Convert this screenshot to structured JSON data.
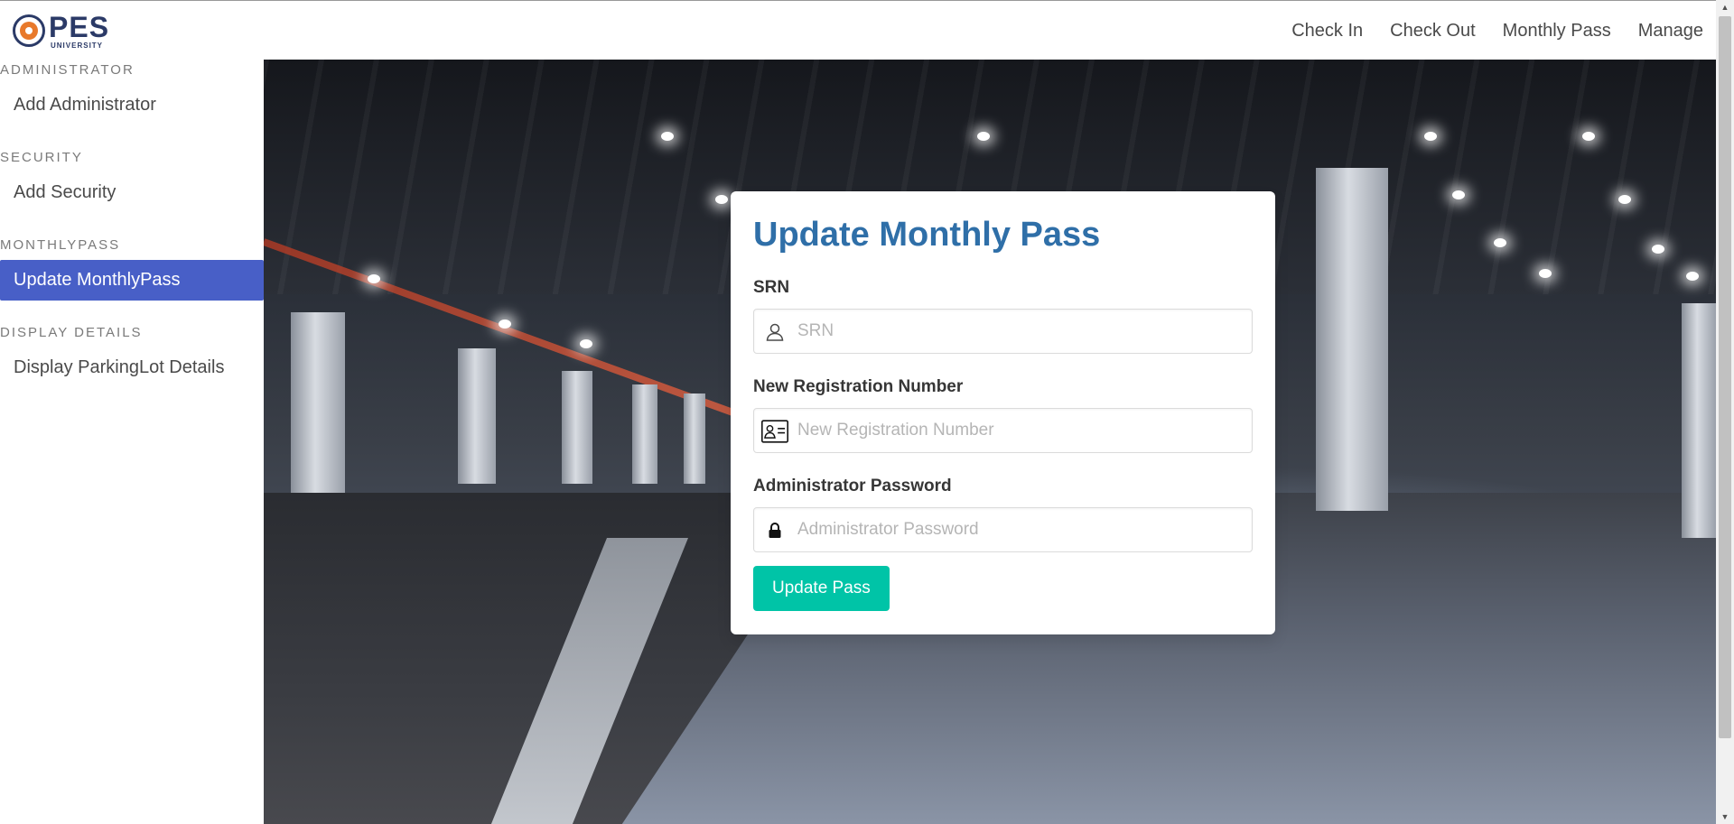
{
  "brand": {
    "main": "PES",
    "sub": "UNIVERSITY"
  },
  "nav": {
    "links": [
      "Check In",
      "Check Out",
      "Monthly Pass",
      "Manage"
    ]
  },
  "sidebar": {
    "sections": [
      {
        "label": "ADMINISTRATOR",
        "item": "Add Administrator"
      },
      {
        "label": "SECURITY",
        "item": "Add Security"
      },
      {
        "label": "MONTHLYPASS",
        "item": "Update MonthlyPass"
      },
      {
        "label": "DISPLAY DETAILS",
        "item": "Display ParkingLot Details"
      }
    ],
    "active_item": "Update MonthlyPass"
  },
  "form": {
    "title": "Update Monthly Pass",
    "fields": [
      {
        "label": "SRN",
        "placeholder": "SRN",
        "value": "",
        "icon": "user-icon"
      },
      {
        "label": "New Registration Number",
        "placeholder": "New Registration Number",
        "value": "",
        "icon": "id-card-icon"
      },
      {
        "label": "Administrator Password",
        "placeholder": "Administrator Password",
        "value": "",
        "icon": "lock-icon"
      }
    ],
    "submit_label": "Update Pass"
  },
  "colors": {
    "title": "#2f6fa8",
    "active_menu": "#485fc7",
    "button": "#00c4a7"
  }
}
